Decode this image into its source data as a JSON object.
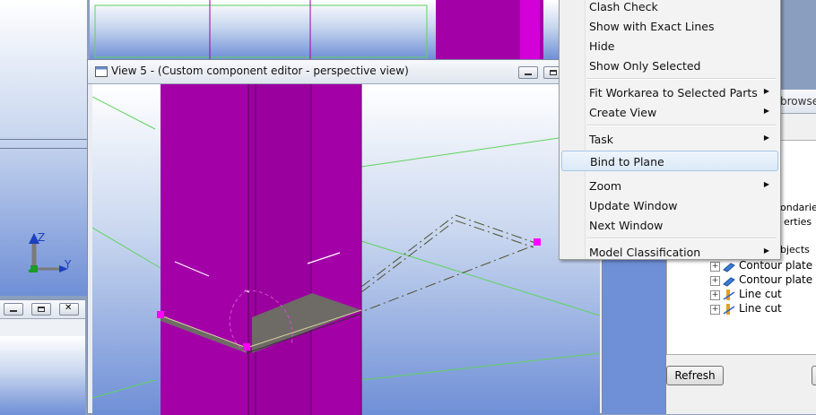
{
  "view5": {
    "title": "View 5 - (Custom component editor - perspective view)"
  },
  "context_menu": {
    "items": [
      {
        "label": "Clash Check",
        "submenu": false
      },
      {
        "label": "Show with Exact Lines",
        "submenu": false
      },
      {
        "label": "Hide",
        "submenu": false
      },
      {
        "label": "Show Only Selected",
        "submenu": false
      },
      {
        "label": "Fit Workarea to Selected Parts",
        "submenu": true
      },
      {
        "label": "Create View",
        "submenu": true
      },
      {
        "label": "Task",
        "submenu": true
      },
      {
        "label": "Bind to Plane",
        "submenu": false,
        "highlighted": true
      },
      {
        "label": "Zoom",
        "submenu": true
      },
      {
        "label": "Update Window",
        "submenu": false
      },
      {
        "label": "Next Window",
        "submenu": false
      },
      {
        "label": "Model Classification",
        "submenu": true
      }
    ],
    "arrow_glyph": "▶"
  },
  "browser_panel": {
    "title_fragment": "browse",
    "partial_items": [
      "ondarie",
      "erties",
      "bjects"
    ],
    "tree_items": [
      "Contour plate",
      "Contour plate",
      "Line cut",
      "Line cut"
    ],
    "refresh_label": "Refresh"
  },
  "axis": {
    "z": "Z",
    "y": "Y"
  },
  "colors": {
    "column": "#a400a8",
    "column_dark": "#8a008f",
    "handle": "#ff00ff",
    "plate": "#6e6a66",
    "axis_z": "#1d3fbf",
    "axis_y": "#1d3fbf",
    "axis_green": "#1a9b2a",
    "menu_bg": "#f3f3f3",
    "highlight_border": "#a9c6e6"
  }
}
